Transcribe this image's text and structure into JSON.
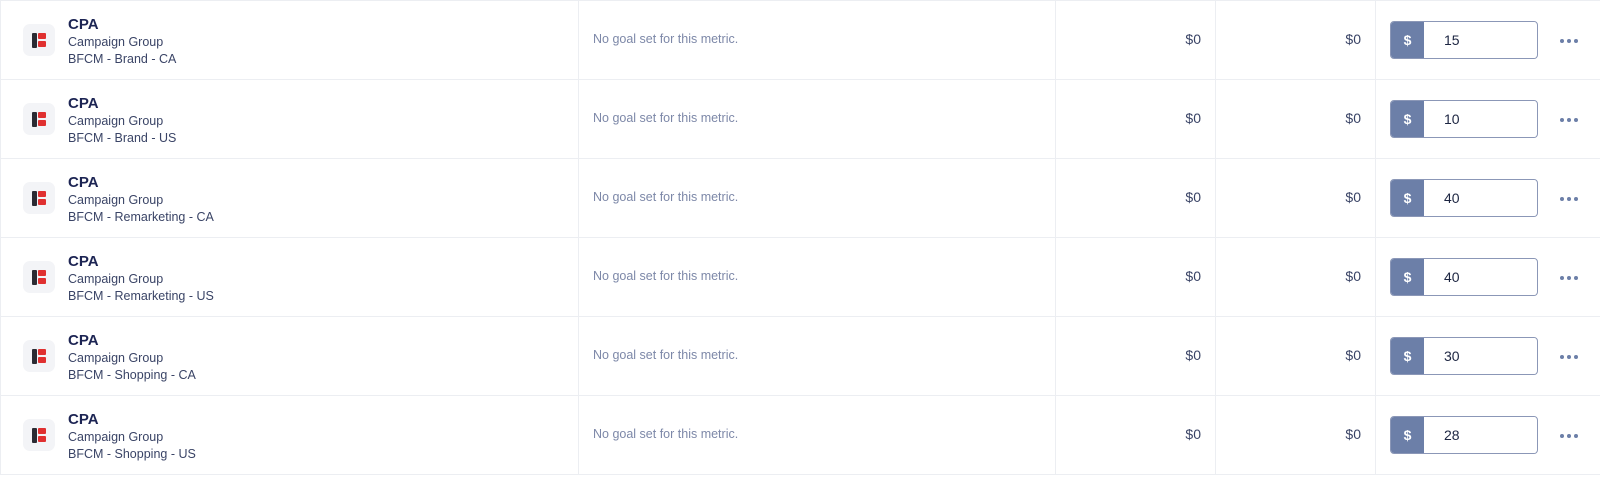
{
  "rows": [
    {
      "metric": "CPA",
      "group_type": "Campaign Group",
      "group_name": "BFCM - Brand - CA",
      "goal_text": "No goal set for this metric.",
      "value1": "$0",
      "value2": "$0",
      "currency_symbol": "$",
      "target_value": "15"
    },
    {
      "metric": "CPA",
      "group_type": "Campaign Group",
      "group_name": "BFCM - Brand - US",
      "goal_text": "No goal set for this metric.",
      "value1": "$0",
      "value2": "$0",
      "currency_symbol": "$",
      "target_value": "10"
    },
    {
      "metric": "CPA",
      "group_type": "Campaign Group",
      "group_name": "BFCM - Remarketing - CA",
      "goal_text": "No goal set for this metric.",
      "value1": "$0",
      "value2": "$0",
      "currency_symbol": "$",
      "target_value": "40"
    },
    {
      "metric": "CPA",
      "group_type": "Campaign Group",
      "group_name": "BFCM - Remarketing - US",
      "goal_text": "No goal set for this metric.",
      "value1": "$0",
      "value2": "$0",
      "currency_symbol": "$",
      "target_value": "40"
    },
    {
      "metric": "CPA",
      "group_type": "Campaign Group",
      "group_name": "BFCM - Shopping - CA",
      "goal_text": "No goal set for this metric.",
      "value1": "$0",
      "value2": "$0",
      "currency_symbol": "$",
      "target_value": "30"
    },
    {
      "metric": "CPA",
      "group_type": "Campaign Group",
      "group_name": "BFCM - Shopping - US",
      "goal_text": "No goal set for this metric.",
      "value1": "$0",
      "value2": "$0",
      "currency_symbol": "$",
      "target_value": "28"
    }
  ],
  "icons": {
    "platform_logo": "platform-logo-icon",
    "row_menu": "more-horizontal-icon"
  },
  "colors": {
    "prefix_bg": "#6c7fa8",
    "logo_red": "#e03030",
    "metric_text": "#1c2453"
  }
}
